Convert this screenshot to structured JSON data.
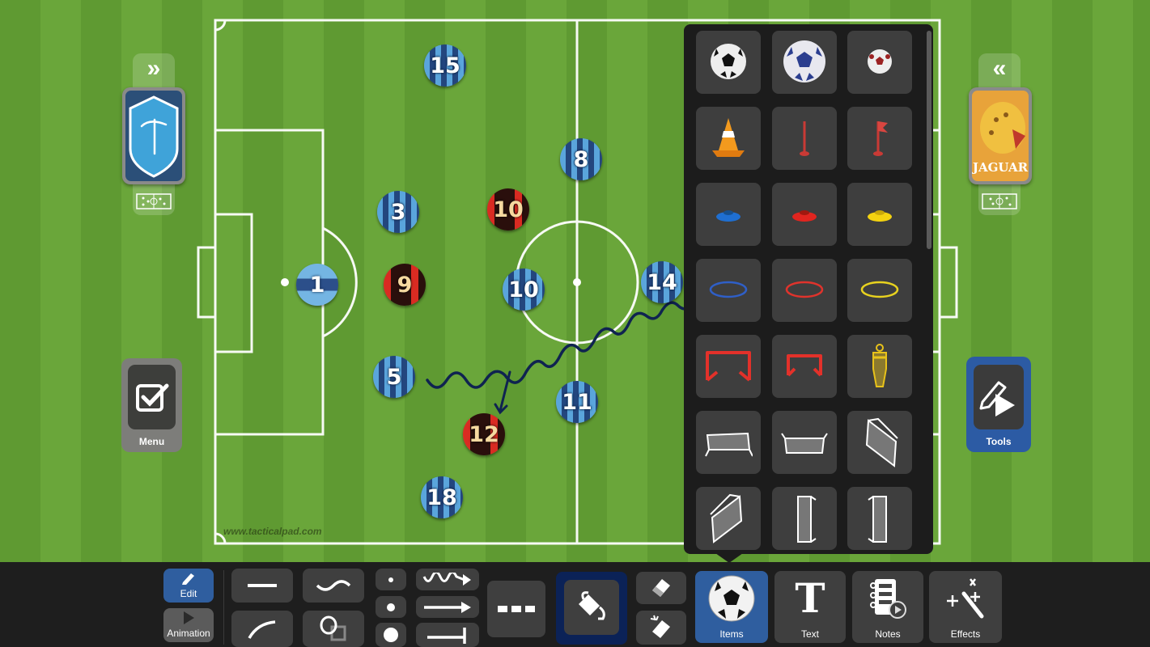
{
  "app": {
    "name": "TacticalPad"
  },
  "watermark": "www.tacticalpad.com",
  "colors": {
    "accent_blue": "#2f5e9f",
    "home_team_dark": "#23467e",
    "home_team_light": "#5aa5dc",
    "away_team_red": "#d92b22",
    "away_team_dark": "#2a0f0c",
    "movement_line": "#0f2350"
  },
  "left_panel": {
    "expand_icon": "double-chevron-right-icon",
    "team_logo": "tacticalpad-shield-logo",
    "formation_icon": "formation-icon",
    "menu_label": "Menu",
    "menu_icon": "checkbox-icon"
  },
  "right_panel": {
    "collapse_icon": "double-chevron-left-icon",
    "team_logo_text": "JAGUAR",
    "formation_icon": "formation-icon",
    "tools_label": "Tools",
    "tools_icon": "pencil-play-icon"
  },
  "players": [
    {
      "team": "home-gk",
      "number": "1"
    },
    {
      "team": "home",
      "number": "15"
    },
    {
      "team": "home",
      "number": "3"
    },
    {
      "team": "home",
      "number": "5"
    },
    {
      "team": "home",
      "number": "18"
    },
    {
      "team": "home",
      "number": "10"
    },
    {
      "team": "home",
      "number": "8"
    },
    {
      "team": "home",
      "number": "11"
    },
    {
      "team": "home",
      "number": "14"
    },
    {
      "team": "away",
      "number": "10"
    },
    {
      "team": "away",
      "number": "9"
    },
    {
      "team": "away",
      "number": "12"
    }
  ],
  "items_panel": {
    "items": [
      {
        "name": "soccer-ball-black",
        "icon": "soccer-ball-icon"
      },
      {
        "name": "soccer-ball-blue",
        "icon": "soccer-ball-icon"
      },
      {
        "name": "soccer-ball-red-small",
        "icon": "soccer-ball-icon"
      },
      {
        "name": "traffic-cone",
        "icon": "cone-icon"
      },
      {
        "name": "pole",
        "icon": "pole-icon"
      },
      {
        "name": "corner-flag",
        "icon": "flag-icon"
      },
      {
        "name": "disc-cone-blue",
        "icon": "disc-cone-icon"
      },
      {
        "name": "disc-cone-red",
        "icon": "disc-cone-icon"
      },
      {
        "name": "disc-cone-yellow",
        "icon": "disc-cone-icon"
      },
      {
        "name": "ring-blue",
        "icon": "ring-icon"
      },
      {
        "name": "ring-red",
        "icon": "ring-icon"
      },
      {
        "name": "ring-yellow",
        "icon": "ring-icon"
      },
      {
        "name": "mini-goal-large",
        "icon": "mini-goal-icon"
      },
      {
        "name": "mini-goal-small",
        "icon": "mini-goal-icon"
      },
      {
        "name": "mannequin",
        "icon": "mannequin-icon"
      },
      {
        "name": "goal-front",
        "icon": "goal-net-icon"
      },
      {
        "name": "goal-back",
        "icon": "goal-net-icon"
      },
      {
        "name": "goal-angled-right",
        "icon": "goal-net-icon"
      },
      {
        "name": "goal-angled-left",
        "icon": "goal-net-icon"
      },
      {
        "name": "goal-vertical-left",
        "icon": "goal-net-icon"
      },
      {
        "name": "goal-vertical-right",
        "icon": "goal-net-icon"
      }
    ]
  },
  "toolbar": {
    "edit_label": "Edit",
    "animation_label": "Animation",
    "items_label": "Items",
    "text_label": "Text",
    "notes_label": "Notes",
    "effects_label": "Effects",
    "text_glyph": "T",
    "line_tools": [
      "straight-line",
      "wavy-line",
      "curved-line",
      "shapes"
    ],
    "point_sizes": [
      "small",
      "medium",
      "large"
    ],
    "line_ends": [
      "zigzag-arrow",
      "arrow",
      "t-end"
    ],
    "line_style": "dashed",
    "fill_tool": "paint-bucket",
    "erasers": [
      "eraser",
      "clear-all-eraser"
    ],
    "active_tab": "Items"
  }
}
